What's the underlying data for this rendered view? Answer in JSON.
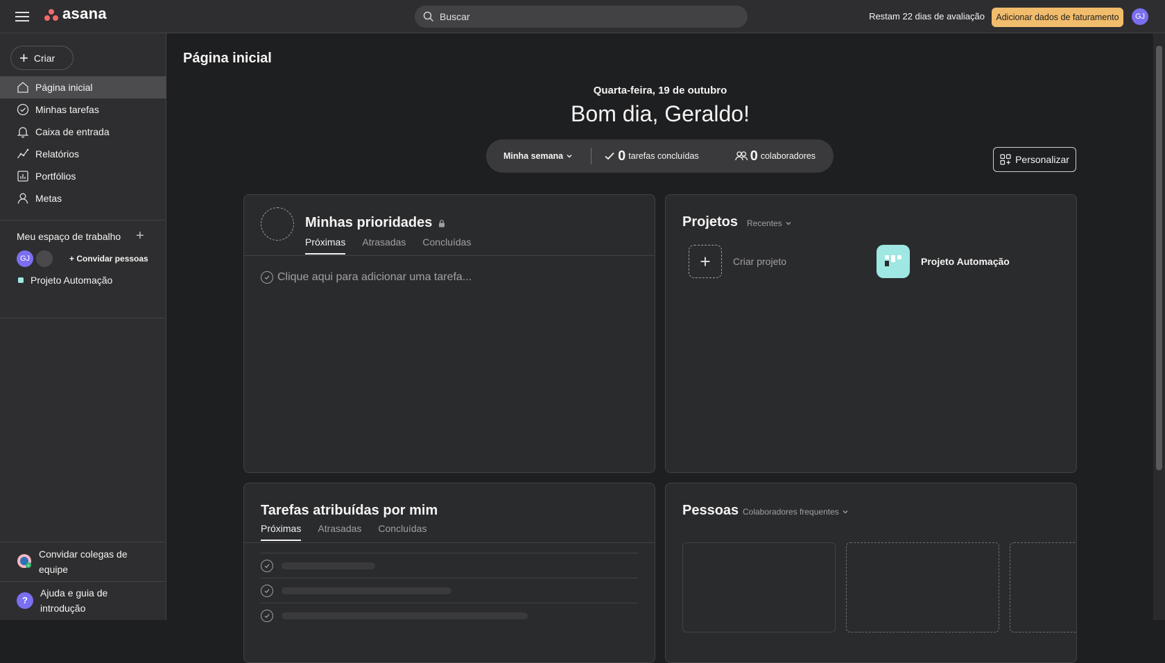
{
  "topbar": {
    "logo_text": "asana",
    "search_placeholder": "Buscar",
    "trial_text": "Restam 22 dias de avaliação",
    "billing_button": "Adicionar dados de faturamento",
    "avatar_initials": "GJ"
  },
  "sidebar": {
    "create_label": "Criar",
    "nav": [
      {
        "label": "Página inicial",
        "icon": "home-icon"
      },
      {
        "label": "Minhas tarefas",
        "icon": "check-circle-icon"
      },
      {
        "label": "Caixa de entrada",
        "icon": "bell-icon"
      },
      {
        "label": "Relatórios",
        "icon": "chart-line-icon"
      },
      {
        "label": "Portfólios",
        "icon": "bar-chart-icon"
      },
      {
        "label": "Metas",
        "icon": "person-icon"
      }
    ],
    "workspace_title": "Meu espaço de trabalho",
    "workspace_avatar": "GJ",
    "invite_people": "Convidar pessoas",
    "project": "Projeto Automação",
    "invite_colleagues": "Convidar colegas de equipe",
    "help": "Ajuda e guia de introdução"
  },
  "main": {
    "page_title": "Página inicial",
    "date": "Quarta-feira, 19 de outubro",
    "greeting": "Bom dia, Geraldo!",
    "stats": {
      "period": "Minha semana",
      "tasks_count": "0",
      "tasks_label": "tarefas concluídas",
      "collab_count": "0",
      "collab_label": "colaboradores"
    },
    "personalize": "Personalizar",
    "priorities": {
      "title": "Minhas prioridades",
      "tabs": [
        "Próximas",
        "Atrasadas",
        "Concluídas"
      ],
      "add_task": "Clique aqui para adicionar uma tarefa..."
    },
    "projects": {
      "title": "Projetos",
      "filter": "Recentes",
      "create": "Criar projeto",
      "project_name": "Projeto Automação"
    },
    "assigned": {
      "title": "Tarefas atribuídas por mim",
      "tabs": [
        "Próximas",
        "Atrasadas",
        "Concluídas"
      ]
    },
    "people": {
      "title": "Pessoas",
      "filter": "Colaboradores frequentes"
    }
  },
  "colors": {
    "background": "#1e1f21",
    "topbar": "#2e2e30",
    "billing_button": "#f1bd6c",
    "avatar": "#7a6ff0",
    "project_tile": "#9ee7e3",
    "logo": "#f06a6a"
  }
}
